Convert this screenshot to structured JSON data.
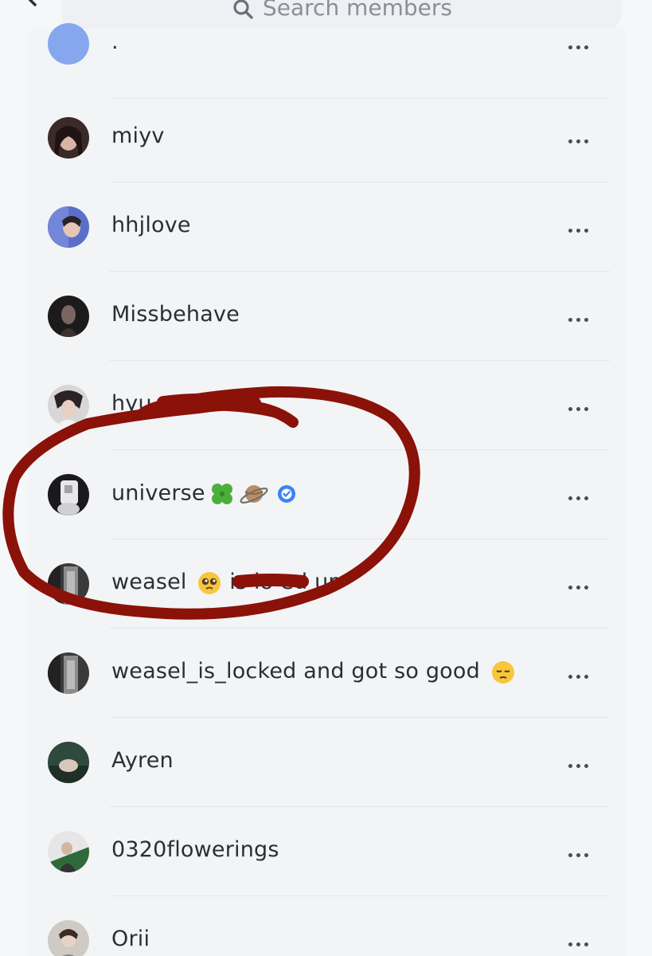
{
  "search": {
    "placeholder": "Search members"
  },
  "members": [
    {
      "name": ".",
      "avatar": "blue-circle"
    },
    {
      "name": "miyv",
      "avatar": "photo"
    },
    {
      "name": "hhjlove",
      "avatar": "photo"
    },
    {
      "name": "Missbehave",
      "avatar": "photo"
    },
    {
      "name": "hyu",
      "avatar": "photo"
    },
    {
      "name": "universe",
      "avatar": "photo",
      "emojis": [
        "four-leaf-clover",
        "planet"
      ],
      "verified": true
    },
    {
      "name_start": "weasel",
      "name_end": "is lo   ed up",
      "avatar": "photo",
      "emojis": [
        "pleading-face"
      ]
    },
    {
      "name": "weasel_is_locked and got so good",
      "avatar": "photo",
      "emojis": [
        "pensive-face"
      ]
    },
    {
      "name": "Ayren",
      "avatar": "photo"
    },
    {
      "name": "0320flowerings",
      "avatar": "photo"
    },
    {
      "name": "Orii",
      "avatar": "photo"
    }
  ],
  "colors": {
    "background": "#f6f7f9",
    "verified": "#3b82f6",
    "annotation_circle": "#8b1208"
  },
  "icons": {
    "back": "arrow-left-icon",
    "search": "search-icon",
    "more": "more-horizontal-icon",
    "verified": "verified-badge-icon"
  }
}
